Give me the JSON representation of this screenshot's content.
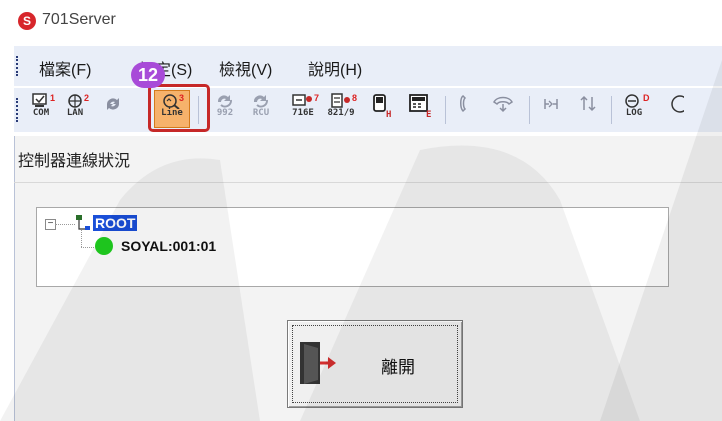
{
  "window": {
    "title": "701Server",
    "logo_letter": "S"
  },
  "menu": {
    "items": [
      "檔案(F)",
      "設定(S)",
      "檢視(V)",
      "說明(H)"
    ]
  },
  "toolbar": {
    "buttons": [
      {
        "name": "com",
        "label": "COM",
        "sup": "1"
      },
      {
        "name": "lan",
        "label": "LAN",
        "sup": "2"
      },
      {
        "name": "refresh",
        "label": "",
        "sup": ""
      },
      {
        "name": "line",
        "label": "Line",
        "sup": "3"
      },
      {
        "name": "992",
        "label": "992",
        "sup": ""
      },
      {
        "name": "rcu",
        "label": "RCU",
        "sup": ""
      },
      {
        "name": "716e",
        "label": "716E",
        "sup": "7"
      },
      {
        "name": "821-9",
        "label": "821/9",
        "sup": "8"
      },
      {
        "name": "h",
        "label": "H",
        "sup": ""
      },
      {
        "name": "e",
        "label": "E",
        "sup": ""
      },
      {
        "name": "log",
        "label": "LOG",
        "sup": "D"
      }
    ]
  },
  "annotation": {
    "step": "12"
  },
  "panel": {
    "title": "控制器連線狀況",
    "tree": {
      "root": "ROOT",
      "child": "SOYAL:001:01"
    }
  },
  "exit_button": {
    "label": "離開"
  },
  "colors": {
    "accent": "#1a4fd8",
    "highlight": "#c62828",
    "badge": "#a84bd8",
    "online": "#20d020"
  }
}
